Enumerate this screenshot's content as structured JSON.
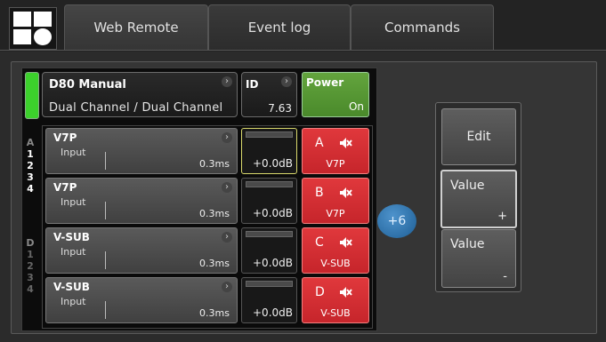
{
  "tabs": [
    {
      "label": "Web Remote",
      "active": true
    },
    {
      "label": "Event log",
      "active": false
    },
    {
      "label": "Commands",
      "active": false
    }
  ],
  "amp": {
    "name": "D80 Manual",
    "mode": "Dual Channel / Dual Channel",
    "id_label": "ID",
    "id_value": "7.63",
    "power_label": "Power",
    "power_value": "On",
    "status_color": "#3cd12c"
  },
  "channel_groups": [
    {
      "letter": "A",
      "inputs": [
        "1",
        "2",
        "3",
        "4"
      ]
    },
    {
      "letter": "D",
      "inputs": [
        "1",
        "2",
        "3",
        "4"
      ]
    }
  ],
  "channels": [
    {
      "preset": "V7P",
      "input_label": "Input",
      "delay": "0.3ms",
      "gain": "+0.0dB",
      "mute_letter": "A",
      "mute_preset": "V7P",
      "selected": true
    },
    {
      "preset": "V7P",
      "input_label": "Input",
      "delay": "0.3ms",
      "gain": "+0.0dB",
      "mute_letter": "B",
      "mute_preset": "V7P",
      "selected": false
    },
    {
      "preset": "V-SUB",
      "input_label": "Input",
      "delay": "0.3ms",
      "gain": "+0.0dB",
      "mute_letter": "C",
      "mute_preset": "V-SUB",
      "selected": false
    },
    {
      "preset": "V-SUB",
      "input_label": "Input",
      "delay": "0.3ms",
      "gain": "+0.0dB",
      "mute_letter": "D",
      "mute_preset": "V-SUB",
      "selected": false
    }
  ],
  "step_button": "+6",
  "side": {
    "edit": "Edit",
    "value_up": "Value",
    "value_up_sym": "+",
    "value_down": "Value",
    "value_down_sym": "-"
  },
  "colors": {
    "mute_red": "#c6252b",
    "power_green": "#4a8a2b",
    "accent_blue": "#1e5f96",
    "selected_outline": "#d9d96c"
  }
}
